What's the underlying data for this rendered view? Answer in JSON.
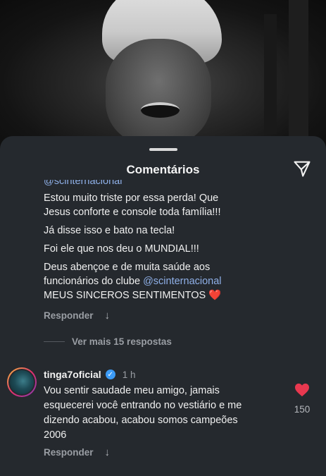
{
  "sheet": {
    "title": "Comentários"
  },
  "comment1": {
    "cut_mention": "@scinternacional",
    "lines": [
      "Estou muito triste por essa perda! Que",
      "Jesus conforte e console toda família!!!",
      "Já disse isso e bato na tecla!",
      "Foi ele que nos deu o MUNDIAL!!!",
      "Deus abençoe  e de muita saúde aos",
      "funcionários do clube ",
      "MEUS SINCEROS SENTIMENTOS "
    ],
    "mention": "@scinternacional",
    "emoji": "❤️",
    "reply_label": "Responder",
    "reply_icon": "↓"
  },
  "more_replies": {
    "label": "Ver mais 15 respostas"
  },
  "comment2": {
    "username": "tinga7oficial",
    "verified_icon": "✓",
    "time": "1 h",
    "lines": [
      "Vou sentir saudade meu amigo, jamais",
      "esquecerei você entrando no vestiário e me",
      "dizendo acabou, acabou somos campeões",
      "2006"
    ],
    "reply_label": "Responder",
    "reply_icon": "↓",
    "likes": "150"
  },
  "colors": {
    "sheet_bg": "#25292e",
    "mention": "#8fb0e8",
    "like_heart": "#e8384f",
    "verified": "#3c9bf6",
    "muted_text": "#9a9ea4"
  },
  "icons": {
    "share": "send-icon",
    "like": "heart-icon",
    "verified": "verified-badge-icon",
    "reply_down": "arrow-down-icon"
  }
}
